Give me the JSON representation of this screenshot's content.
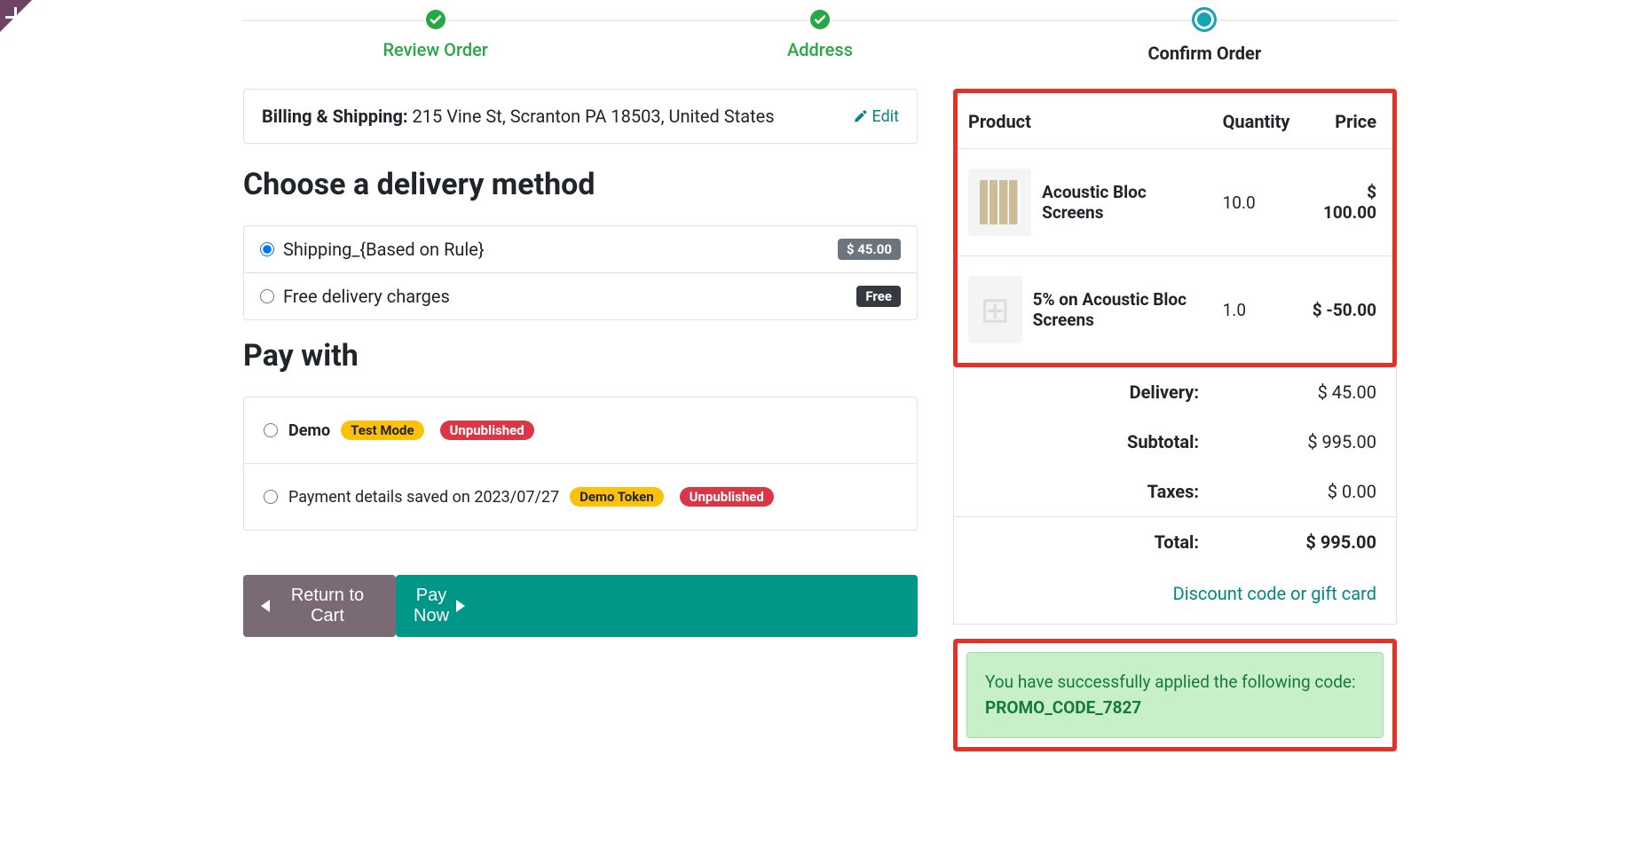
{
  "progress": {
    "steps": [
      {
        "label": "Review Order",
        "state": "done"
      },
      {
        "label": "Address",
        "state": "done"
      },
      {
        "label": "Confirm Order",
        "state": "active"
      }
    ]
  },
  "shipping": {
    "label": "Billing & Shipping:",
    "address": "215 Vine St, Scranton PA 18503, United States",
    "edit": "Edit"
  },
  "delivery": {
    "heading": "Choose a delivery method",
    "options": [
      {
        "label": "Shipping_{Based on Rule}",
        "badge": "$ 45.00",
        "badge_style": "grey",
        "checked": true
      },
      {
        "label": "Free delivery charges",
        "badge": "Free",
        "badge_style": "dark",
        "checked": false
      }
    ]
  },
  "pay": {
    "heading": "Pay with",
    "options": [
      {
        "label": "Demo",
        "bold": true,
        "pills": [
          {
            "text": "Test Mode",
            "style": "yellow"
          },
          {
            "text": "Unpublished",
            "style": "red"
          }
        ]
      },
      {
        "label": "Payment details saved on 2023/07/27",
        "bold": false,
        "pills": [
          {
            "text": "Demo Token",
            "style": "yellow"
          },
          {
            "text": "Unpublished",
            "style": "red"
          }
        ]
      }
    ]
  },
  "actions": {
    "back": "Return to Cart",
    "forward": "Pay Now"
  },
  "summary": {
    "headers": {
      "product": "Product",
      "quantity": "Quantity",
      "price": "Price"
    },
    "items": [
      {
        "name": "Acoustic Bloc Screens",
        "qty": "10.0",
        "price": "$ 100.00",
        "thumb": "screen"
      },
      {
        "name": "5% on Acoustic Bloc Screens",
        "qty": "1.0",
        "price": "$ -50.00",
        "thumb": "grid"
      }
    ],
    "lines": [
      {
        "label": "Delivery:",
        "value": "$ 45.00"
      },
      {
        "label": "Subtotal:",
        "value": "$ 995.00"
      },
      {
        "label": "Taxes:",
        "value": "$ 0.00"
      }
    ],
    "total": {
      "label": "Total:",
      "value": "$ 995.00"
    },
    "discount_link": "Discount code or gift card"
  },
  "promo": {
    "prefix": "You have successfully applied the following code: ",
    "code": "PROMO_CODE_7827"
  }
}
